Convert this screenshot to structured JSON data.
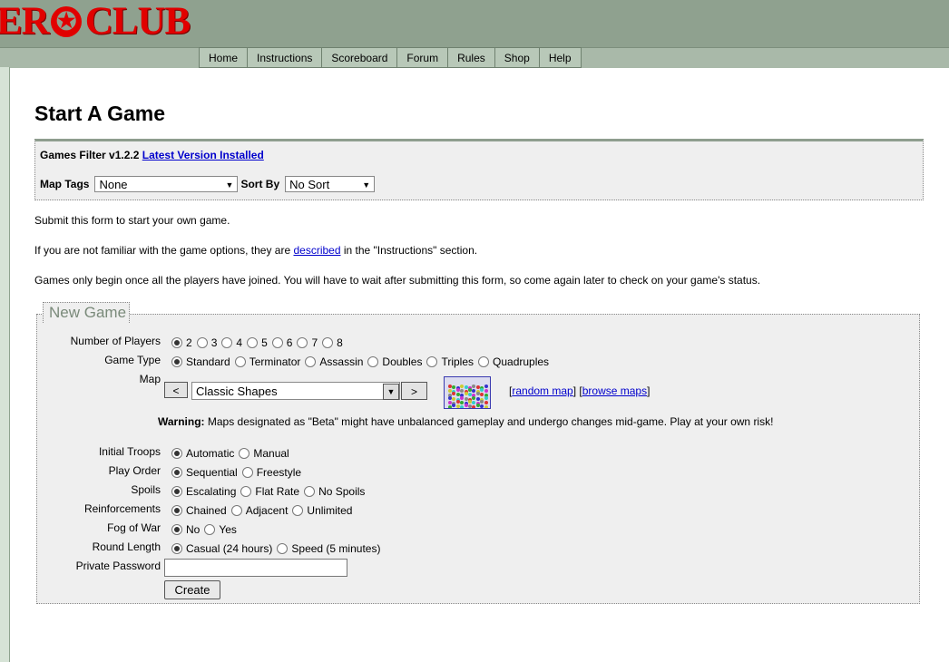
{
  "brand": {
    "logo_left": "ER",
    "logo_star": "✪",
    "logo_right": "CLUB"
  },
  "nav": [
    "Home",
    "Instructions",
    "Scoreboard",
    "Forum",
    "Rules",
    "Shop",
    "Help"
  ],
  "page_title": "Start A Game",
  "filter": {
    "version": "Games Filter v1.2.2",
    "latest_link": "Latest Version Installed",
    "map_tags_label": "Map Tags",
    "map_tags_value": "None",
    "sort_by_label": "Sort By",
    "sort_by_value": "No Sort"
  },
  "info": {
    "line1": "Submit this form to start your own game.",
    "line2_before": "If you are not familiar with the game options, they are ",
    "line2_link": "described",
    "line2_after": " in the \"Instructions\" section.",
    "line3": "Games only begin once all the players have joined. You will have to wait after submitting this form, so come again later to check on your game's status."
  },
  "form": {
    "legend": "New Game",
    "players_label": "Number of Players",
    "players": [
      "2",
      "3",
      "4",
      "5",
      "6",
      "7",
      "8"
    ],
    "game_type_label": "Game Type",
    "game_types": [
      "Standard",
      "Terminator",
      "Assassin",
      "Doubles",
      "Triples",
      "Quadruples"
    ],
    "map_label": "Map",
    "map_prev": "<",
    "map_next": ">",
    "map_value": "Classic Shapes",
    "random_map": "random map",
    "browse_maps": "browse maps",
    "warning_bold": "Warning:",
    "warning_text": " Maps designated as \"Beta\" might have unbalanced gameplay and undergo changes mid-game. Play at your own risk!",
    "initial_troops_label": "Initial Troops",
    "initial_troops": [
      "Automatic",
      "Manual"
    ],
    "play_order_label": "Play Order",
    "play_order": [
      "Sequential",
      "Freestyle"
    ],
    "spoils_label": "Spoils",
    "spoils": [
      "Escalating",
      "Flat Rate",
      "No Spoils"
    ],
    "reinforcements_label": "Reinforcements",
    "reinforcements": [
      "Chained",
      "Adjacent",
      "Unlimited"
    ],
    "fog_label": "Fog of War",
    "fog": [
      "No",
      "Yes"
    ],
    "round_label": "Round Length",
    "round": [
      "Casual (24 hours)",
      "Speed (5 minutes)"
    ],
    "password_label": "Private Password",
    "password_value": "",
    "create": "Create"
  }
}
